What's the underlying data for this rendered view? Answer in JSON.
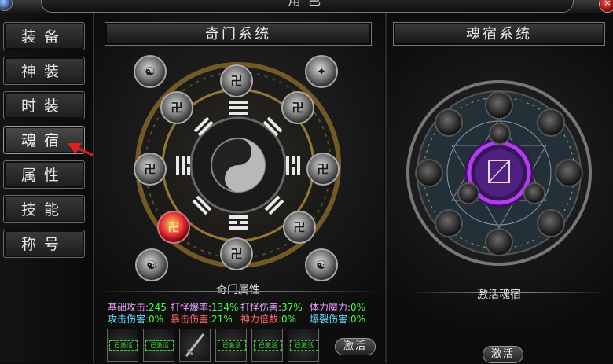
{
  "window": {
    "title": "角色",
    "close_symbol": "×"
  },
  "sidebar": {
    "items": [
      {
        "label": "装备",
        "active": false
      },
      {
        "label": "神装",
        "active": false
      },
      {
        "label": "时装",
        "active": false
      },
      {
        "label": "魂宿",
        "active": true
      },
      {
        "label": "属性",
        "active": false
      },
      {
        "label": "技能",
        "active": false
      },
      {
        "label": "称号",
        "active": false
      }
    ]
  },
  "qimen": {
    "title": "奇门系统",
    "attr_title": "奇门属性",
    "attributes": [
      {
        "label": "基础攻击:",
        "value": "245",
        "color": "#e9a0ff",
        "value_color": "#44ff44"
      },
      {
        "label": "打怪爆率:",
        "value": "134%",
        "color": "#e9a0ff",
        "value_color": "#44ff44"
      },
      {
        "label": "打怪伤害:",
        "value": "37%",
        "color": "#e9a0ff",
        "value_color": "#44ff44"
      },
      {
        "label": "体力魔力:",
        "value": "0%",
        "color": "#e9a0ff",
        "value_color": "#44ff44"
      },
      {
        "label": "攻击伤害:",
        "value": "0%",
        "color": "#66e0ff",
        "value_color": "#44ff44"
      },
      {
        "label": "暴击伤害:",
        "value": "21%",
        "color": "#ff6666",
        "value_color": "#44ff44"
      },
      {
        "label": "神力倍数:",
        "value": "0%",
        "color": "#ff6666",
        "value_color": "#44ff44"
      },
      {
        "label": "爆裂伤害:",
        "value": "0%",
        "color": "#66e0ff",
        "value_color": "#44ff44"
      }
    ],
    "slots": [
      {
        "label": "已激活"
      },
      {
        "label": "已激活"
      },
      {
        "label": ""
      },
      {
        "label": "已激活"
      },
      {
        "label": "已激活"
      },
      {
        "label": "已激活"
      }
    ],
    "activate_button": "激活"
  },
  "hunsu": {
    "title": "魂宿系统",
    "status_label": "激活魂宿",
    "activate_button": "激活"
  },
  "colors": {
    "accent_gold": "#c8a040",
    "magic_purple": "#c040ff",
    "active_green": "#44dd44"
  },
  "icons": {
    "close": "close-icon",
    "orbs": "rune-orb-icon",
    "soul": "soul-orb-icon"
  }
}
